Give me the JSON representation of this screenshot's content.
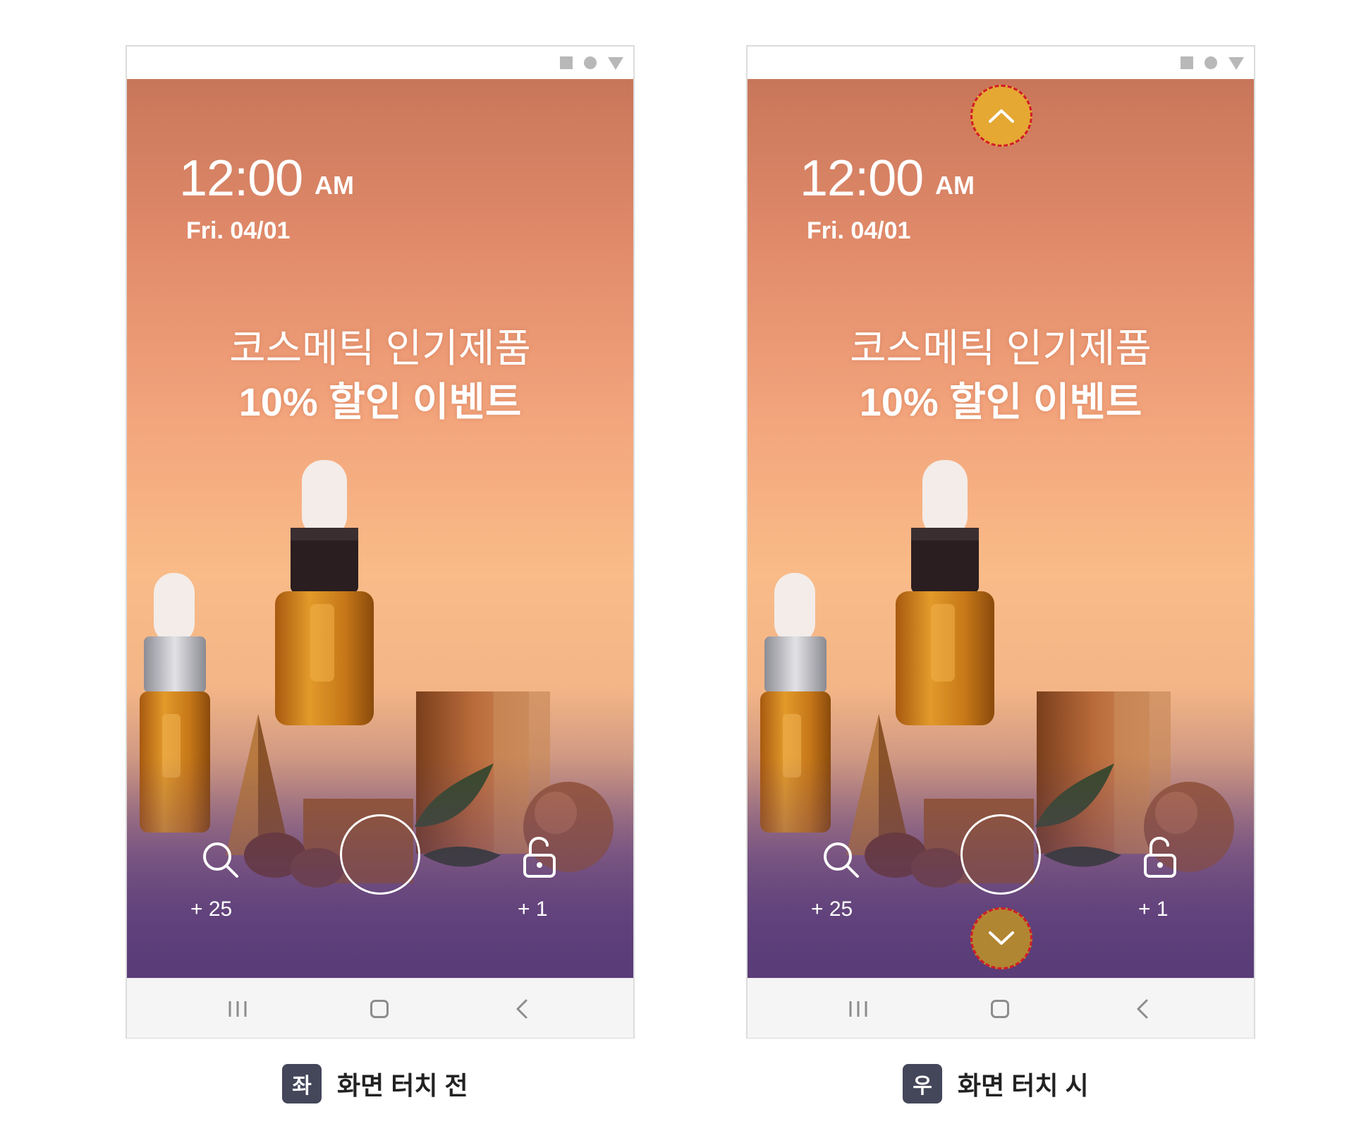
{
  "phones": [
    {
      "time": "12:00",
      "ampm": "AM",
      "date": "Fri. 04/01",
      "promo_line1": "코스메틱 인기제품",
      "promo_line2": "10% 할인 이벤트",
      "search_count": "+ 25",
      "unlock_count": "+ 1",
      "caption_badge": "좌",
      "caption_text": "화면 터치 전"
    },
    {
      "time": "12:00",
      "ampm": "AM",
      "date": "Fri. 04/01",
      "promo_line1": "코스메틱 인기제품",
      "promo_line2": "10% 할인 이벤트",
      "search_count": "+ 25",
      "unlock_count": "+ 1",
      "caption_badge": "우",
      "caption_text": "화면 터치 시"
    }
  ],
  "icons": {
    "status": [
      "square-icon",
      "circle-icon",
      "triangle-down-icon"
    ],
    "screen": [
      "search-icon",
      "unlock-icon",
      "chevron-up-icon",
      "chevron-down-icon"
    ],
    "nav": [
      "recents-icon",
      "home-icon",
      "back-icon"
    ]
  },
  "colors": {
    "arrow_up_fill": "#e4a833",
    "arrow_down_fill": "#b18632",
    "arrow_dash": "#d21b2a",
    "caption_badge": "#44465a"
  }
}
